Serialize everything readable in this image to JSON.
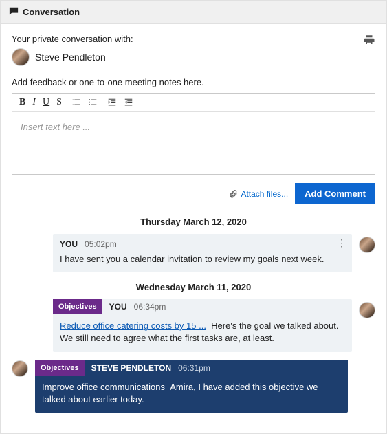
{
  "header": {
    "title": "Conversation"
  },
  "intro_line": "Your private conversation with:",
  "participant": {
    "name": "Steve Pendleton"
  },
  "hint": "Add feedback or one-to-one meeting notes here.",
  "editor": {
    "placeholder": "Insert text here ..."
  },
  "actions": {
    "attach_label": "Attach files...",
    "submit_label": "Add Comment"
  },
  "thread": {
    "groups": [
      {
        "date": "Thursday March 12, 2020",
        "messages": [
          {
            "side": "right",
            "style": "own",
            "badge": null,
            "author": "YOU",
            "time": "05:02pm",
            "link": null,
            "body": "I have sent you a calendar invitation to review my goals next week.",
            "menu": true
          }
        ]
      },
      {
        "date": "Wednesday March 11, 2020",
        "messages": [
          {
            "side": "right",
            "style": "own",
            "badge": "Objectives",
            "author": "YOU",
            "time": "06:34pm",
            "link": "Reduce office catering costs by 15 ...",
            "body": "Here's the goal we talked about. We still need to agree what the first tasks are, at least.",
            "menu": false
          },
          {
            "side": "left",
            "style": "other",
            "badge": "Objectives",
            "author": "STEVE PENDLETON",
            "time": "06:31pm",
            "link": "Improve office communications",
            "body": "Amira, I have added this objective we talked about earlier today.",
            "menu": false
          }
        ]
      }
    ]
  }
}
